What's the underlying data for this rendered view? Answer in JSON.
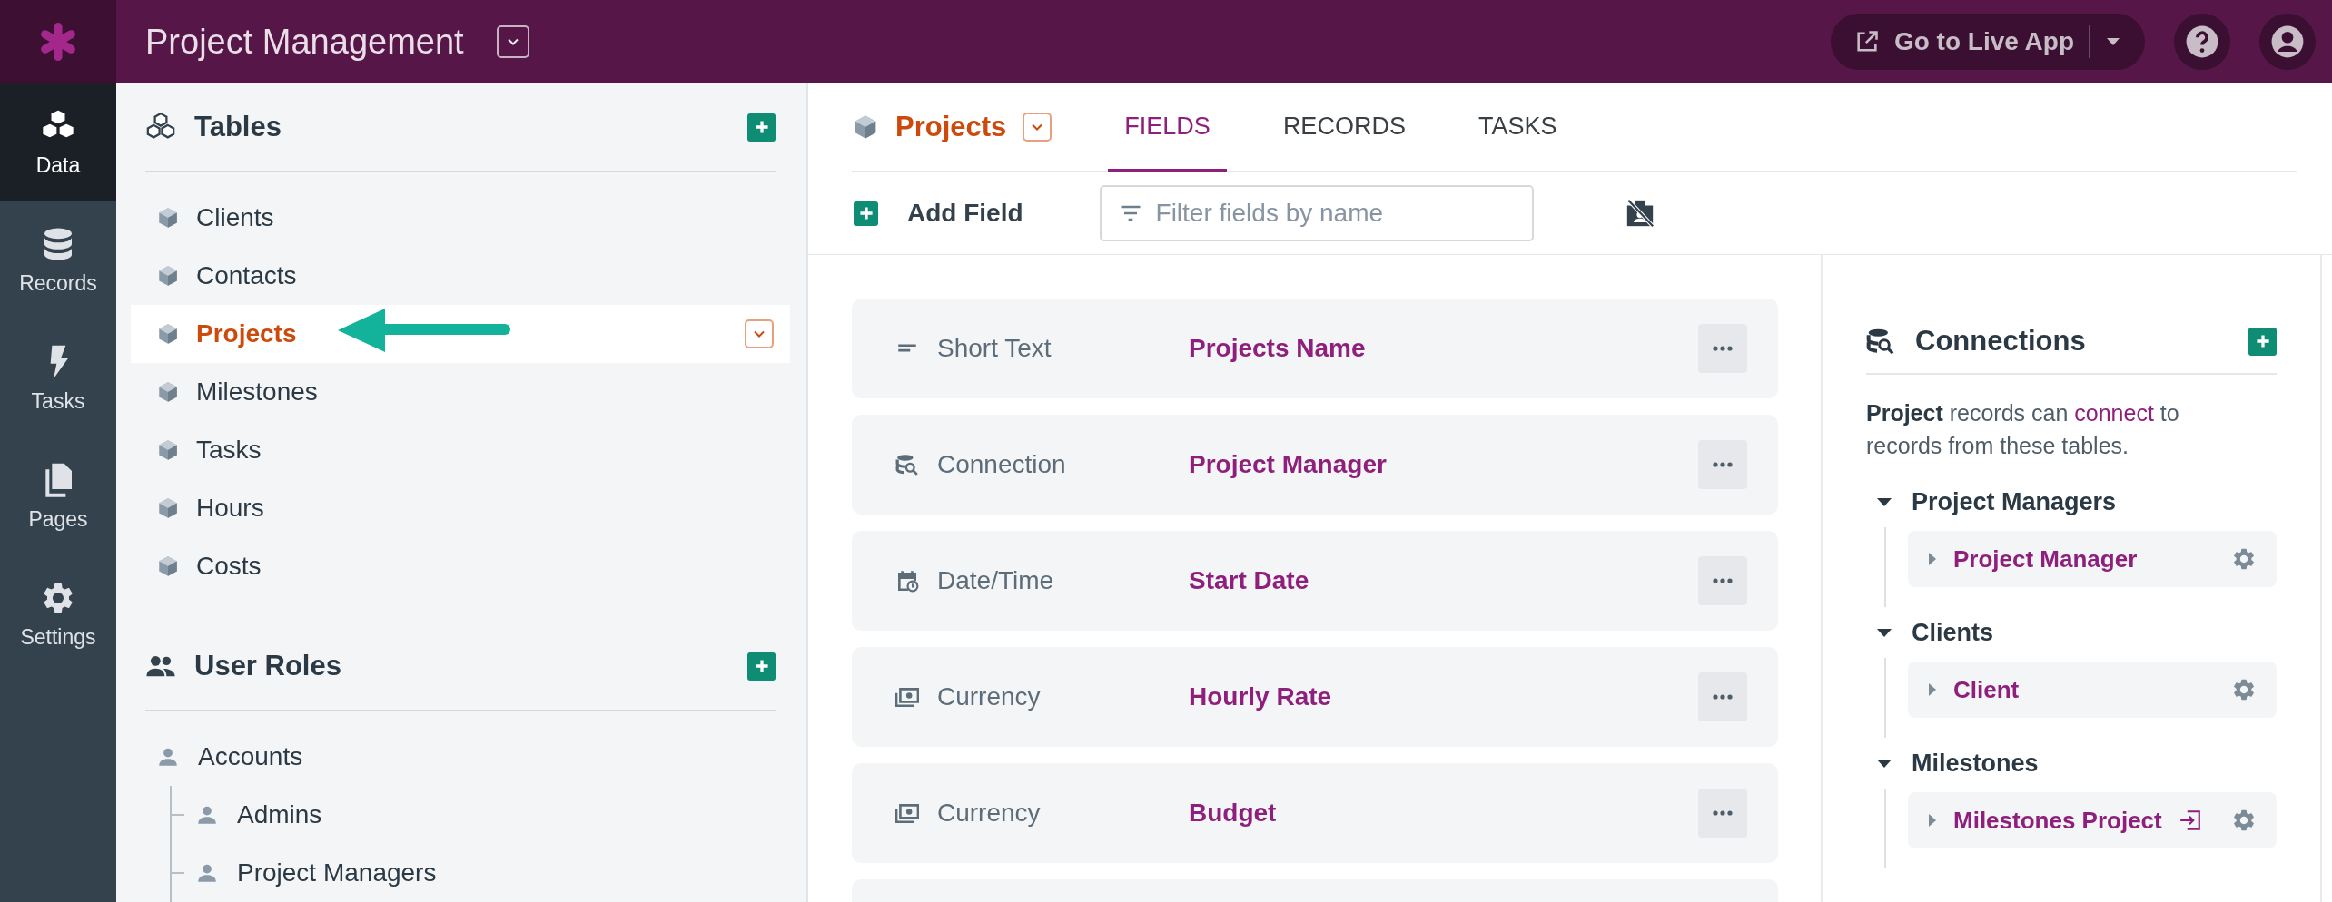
{
  "app_bar": {
    "title": "Project Management",
    "live_app_button": "Go to Live App"
  },
  "nav": [
    {
      "label": "Data",
      "kind": "data",
      "selected": true
    },
    {
      "label": "Records",
      "kind": "records",
      "selected": false
    },
    {
      "label": "Tasks",
      "kind": "tasks",
      "selected": false
    },
    {
      "label": "Pages",
      "kind": "pages",
      "selected": false
    },
    {
      "label": "Settings",
      "kind": "settings",
      "selected": false
    }
  ],
  "tables": {
    "title": "Tables",
    "items": [
      {
        "label": "Clients",
        "selected": false
      },
      {
        "label": "Contacts",
        "selected": false
      },
      {
        "label": "Projects",
        "selected": true
      },
      {
        "label": "Milestones",
        "selected": false
      },
      {
        "label": "Tasks",
        "selected": false
      },
      {
        "label": "Hours",
        "selected": false
      },
      {
        "label": "Costs",
        "selected": false
      }
    ]
  },
  "user_roles": {
    "title": "User Roles",
    "items": [
      {
        "label": "Accounts",
        "children": [
          {
            "label": "Admins"
          },
          {
            "label": "Project Managers"
          }
        ]
      }
    ]
  },
  "table_header": {
    "title": "Projects",
    "tabs": [
      {
        "label": "FIELDS",
        "selected": true
      },
      {
        "label": "RECORDS",
        "selected": false
      },
      {
        "label": "TASKS",
        "selected": false
      }
    ]
  },
  "toolbar": {
    "add_label": "Add Field",
    "filter_placeholder": "Filter fields by name"
  },
  "fields": [
    {
      "kind": "short_text",
      "type": "Short Text",
      "name": "Projects Name"
    },
    {
      "kind": "connection",
      "type": "Connection",
      "name": "Project Manager"
    },
    {
      "kind": "date_time",
      "type": "Date/Time",
      "name": "Start Date"
    },
    {
      "kind": "currency",
      "type": "Currency",
      "name": "Hourly Rate"
    },
    {
      "kind": "currency",
      "type": "Currency",
      "name": "Budget"
    }
  ],
  "connections": {
    "title": "Connections",
    "description_before": "**Project** records can ",
    "link": "connect",
    "description_after": " to records from these tables.",
    "groups": [
      {
        "label": "Project Managers",
        "expanded": true,
        "items": [
          {
            "label": "Project Manager",
            "kind": "outgoing",
            "expanded": false
          }
        ]
      },
      {
        "label": "Clients",
        "expanded": true,
        "items": [
          {
            "label": "Client",
            "kind": "outgoing",
            "expanded": false
          }
        ]
      },
      {
        "label": "Milestones",
        "expanded": true,
        "items": [
          {
            "label": "Milestones Project",
            "kind": "incoming",
            "expanded": false
          }
        ]
      }
    ]
  }
}
